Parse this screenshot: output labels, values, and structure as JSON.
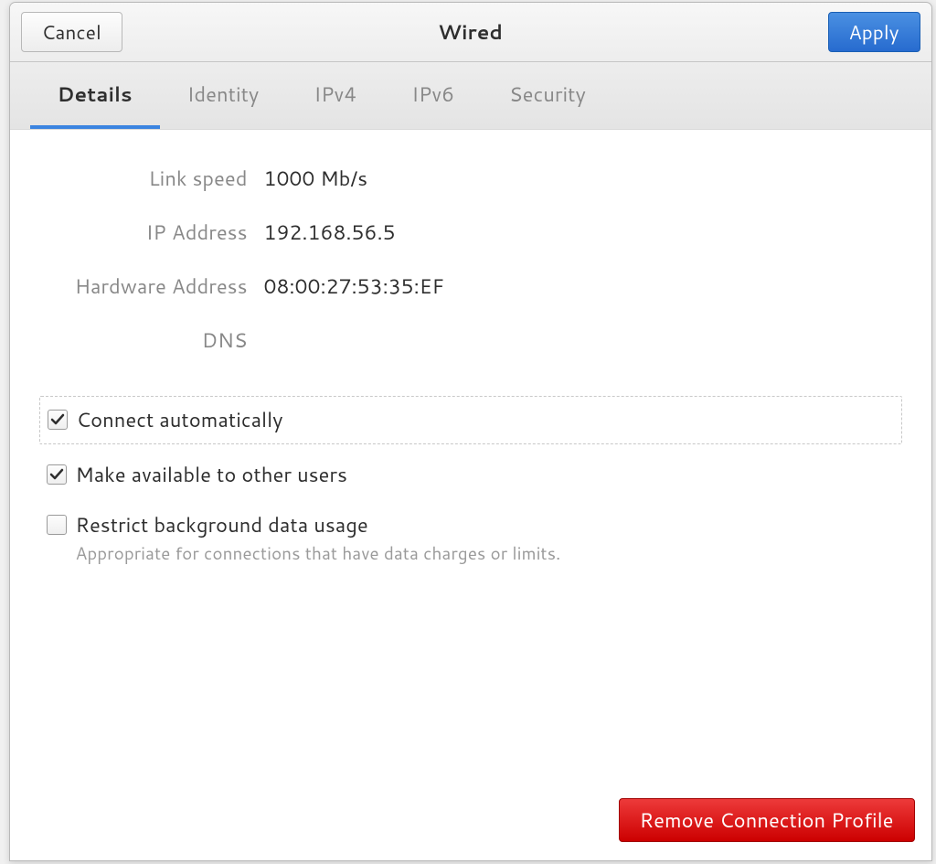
{
  "header": {
    "title": "Wired",
    "cancel_label": "Cancel",
    "apply_label": "Apply"
  },
  "tabs": [
    {
      "label": "Details",
      "active": true
    },
    {
      "label": "Identity",
      "active": false
    },
    {
      "label": "IPv4",
      "active": false
    },
    {
      "label": "IPv6",
      "active": false
    },
    {
      "label": "Security",
      "active": false
    }
  ],
  "details": {
    "link_speed_label": "Link speed",
    "link_speed_value": "1000 Mb/s",
    "ip_address_label": "IP Address",
    "ip_address_value": "192.168.56.5",
    "hw_address_label": "Hardware Address",
    "hw_address_value": "08:00:27:53:35:EF",
    "dns_label": "DNS",
    "dns_value": ""
  },
  "options": {
    "connect_auto": {
      "label": "Connect automatically",
      "checked": true
    },
    "available_others": {
      "label": "Make available to other users",
      "checked": true
    },
    "restrict_bg": {
      "label": "Restrict background data usage",
      "sublabel": "Appropriate for connections that have data charges or limits.",
      "checked": false
    }
  },
  "footer": {
    "remove_label": "Remove Connection Profile"
  }
}
